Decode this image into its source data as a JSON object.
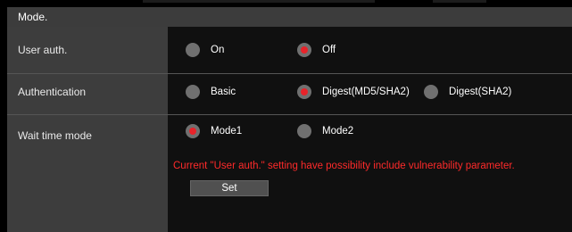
{
  "section": {
    "title": "Mode."
  },
  "rows": [
    {
      "label": "User auth.",
      "options": [
        {
          "label": "On",
          "selected": false
        },
        {
          "label": "Off",
          "selected": true
        }
      ]
    },
    {
      "label": "Authentication",
      "options": [
        {
          "label": "Basic",
          "selected": false
        },
        {
          "label": "Digest(MD5/SHA2)",
          "selected": true
        },
        {
          "label": "Digest(SHA2)",
          "selected": false
        }
      ]
    },
    {
      "label": "Wait time mode",
      "options": [
        {
          "label": "Mode1",
          "selected": true
        },
        {
          "label": "Mode2",
          "selected": false
        }
      ]
    }
  ],
  "warning": "Current \"User auth.\" setting have possibility include vulnerability parameter.",
  "set_button": {
    "label": "Set"
  },
  "colors": {
    "accent": "#e8232a",
    "warning": "#ff2a2a",
    "radio_off": "#707070"
  }
}
